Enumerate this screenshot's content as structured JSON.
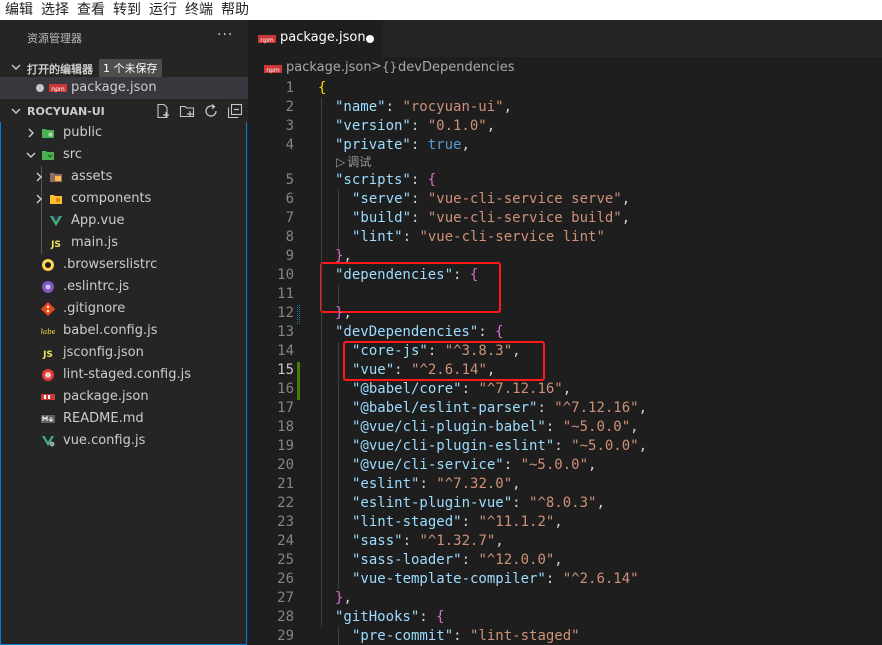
{
  "menu": [
    "编辑",
    "选择",
    "查看",
    "转到",
    "运行",
    "终端",
    "帮助"
  ],
  "sidebar": {
    "title": "资源管理器",
    "more": "···",
    "open_editors": {
      "label": "打开的编辑器",
      "badge": "1 个未保存",
      "files": [
        {
          "name": "package.json",
          "icon": "npm-icon",
          "dirty": true
        }
      ]
    },
    "project": {
      "label": "ROCYUAN-UI",
      "actions": [
        "new-file-icon",
        "new-folder-icon",
        "refresh-icon",
        "collapse-all-icon"
      ],
      "tree": [
        {
          "name": "public",
          "kind": "folder",
          "expanded": false,
          "depth": 0,
          "icon": "public-folder-icon"
        },
        {
          "name": "src",
          "kind": "folder",
          "expanded": true,
          "depth": 0,
          "icon": "src-folder-icon"
        },
        {
          "name": "assets",
          "kind": "folder",
          "expanded": false,
          "depth": 1,
          "icon": "assets-folder-icon"
        },
        {
          "name": "components",
          "kind": "folder",
          "expanded": false,
          "depth": 1,
          "icon": "components-folder-icon"
        },
        {
          "name": "App.vue",
          "kind": "file",
          "depth": 1,
          "icon": "vue-icon"
        },
        {
          "name": "main.js",
          "kind": "file",
          "depth": 1,
          "icon": "js-icon"
        },
        {
          "name": ".browserslistrc",
          "kind": "file",
          "depth": 0,
          "icon": "browserslist-icon"
        },
        {
          "name": ".eslintrc.js",
          "kind": "file",
          "depth": 0,
          "icon": "eslint-icon"
        },
        {
          "name": ".gitignore",
          "kind": "file",
          "depth": 0,
          "icon": "git-icon"
        },
        {
          "name": "babel.config.js",
          "kind": "file",
          "depth": 0,
          "icon": "babel-icon"
        },
        {
          "name": "jsconfig.json",
          "kind": "file",
          "depth": 0,
          "icon": "jsconfig-icon"
        },
        {
          "name": "lint-staged.config.js",
          "kind": "file",
          "depth": 0,
          "icon": "lint-staged-icon"
        },
        {
          "name": "package.json",
          "kind": "file",
          "depth": 0,
          "icon": "npm-icon"
        },
        {
          "name": "README.md",
          "kind": "file",
          "depth": 0,
          "icon": "readme-icon"
        },
        {
          "name": "vue.config.js",
          "kind": "file",
          "depth": 0,
          "icon": "vue-config-icon"
        }
      ]
    }
  },
  "editor": {
    "tab": {
      "label": "package.json",
      "dirty": true
    },
    "breadcrumb": {
      "file": "package.json",
      "separator": ">",
      "symbol_icon": "{}",
      "symbol": "devDependencies"
    },
    "codelens": "调试",
    "current_line": 15,
    "lines": [
      {
        "n": 1,
        "indent": 0,
        "tokens": [
          [
            "br1",
            "{"
          ]
        ]
      },
      {
        "n": 2,
        "indent": 1,
        "tokens": [
          [
            "k",
            "\"name\""
          ],
          [
            "p",
            ": "
          ],
          [
            "s",
            "\"rocyuan-ui\""
          ],
          [
            "p",
            ","
          ]
        ]
      },
      {
        "n": 3,
        "indent": 1,
        "tokens": [
          [
            "k",
            "\"version\""
          ],
          [
            "p",
            ": "
          ],
          [
            "s",
            "\"0.1.0\""
          ],
          [
            "p",
            ","
          ]
        ]
      },
      {
        "n": 4,
        "indent": 1,
        "tokens": [
          [
            "k",
            "\"private\""
          ],
          [
            "p",
            ": "
          ],
          [
            "b",
            "true"
          ],
          [
            "p",
            ","
          ]
        ]
      },
      {
        "n": 5,
        "indent": 1,
        "tokens": [
          [
            "k",
            "\"scripts\""
          ],
          [
            "p",
            ": "
          ],
          [
            "br2",
            "{"
          ]
        ]
      },
      {
        "n": 6,
        "indent": 2,
        "tokens": [
          [
            "k",
            "\"serve\""
          ],
          [
            "p",
            ": "
          ],
          [
            "s",
            "\"vue-cli-service serve\""
          ],
          [
            "p",
            ","
          ]
        ]
      },
      {
        "n": 7,
        "indent": 2,
        "tokens": [
          [
            "k",
            "\"build\""
          ],
          [
            "p",
            ": "
          ],
          [
            "s",
            "\"vue-cli-service build\""
          ],
          [
            "p",
            ","
          ]
        ]
      },
      {
        "n": 8,
        "indent": 2,
        "tokens": [
          [
            "k",
            "\"lint\""
          ],
          [
            "p",
            ": "
          ],
          [
            "s",
            "\"vue-cli-service lint\""
          ]
        ]
      },
      {
        "n": 9,
        "indent": 1,
        "tokens": [
          [
            "br2",
            "}"
          ],
          [
            "p",
            ","
          ]
        ]
      },
      {
        "n": 10,
        "indent": 1,
        "tokens": [
          [
            "k",
            "\"dependencies\""
          ],
          [
            "p",
            ": "
          ],
          [
            "br2",
            "{"
          ]
        ]
      },
      {
        "n": 11,
        "indent": 0,
        "tokens": []
      },
      {
        "n": 12,
        "indent": 1,
        "tokens": [
          [
            "br2",
            "}"
          ],
          [
            "p",
            ","
          ]
        ]
      },
      {
        "n": 13,
        "indent": 1,
        "tokens": [
          [
            "k",
            "\"devDependencies\""
          ],
          [
            "p",
            ": "
          ],
          [
            "br2",
            "{"
          ]
        ]
      },
      {
        "n": 14,
        "indent": 2,
        "tokens": [
          [
            "k",
            "\"core-js\""
          ],
          [
            "p",
            ": "
          ],
          [
            "s",
            "\"^3.8.3\""
          ],
          [
            "p",
            ","
          ]
        ]
      },
      {
        "n": 15,
        "indent": 2,
        "tokens": [
          [
            "k",
            "\"vue\""
          ],
          [
            "p",
            ": "
          ],
          [
            "s",
            "\"^2.6.14\""
          ],
          [
            "p",
            ","
          ]
        ]
      },
      {
        "n": 16,
        "indent": 2,
        "tokens": [
          [
            "k",
            "\"@babel/core\""
          ],
          [
            "p",
            ": "
          ],
          [
            "s",
            "\"^7.12.16\""
          ],
          [
            "p",
            ","
          ]
        ]
      },
      {
        "n": 17,
        "indent": 2,
        "tokens": [
          [
            "k",
            "\"@babel/eslint-parser\""
          ],
          [
            "p",
            ": "
          ],
          [
            "s",
            "\"^7.12.16\""
          ],
          [
            "p",
            ","
          ]
        ]
      },
      {
        "n": 18,
        "indent": 2,
        "tokens": [
          [
            "k",
            "\"@vue/cli-plugin-babel\""
          ],
          [
            "p",
            ": "
          ],
          [
            "s",
            "\"~5.0.0\""
          ],
          [
            "p",
            ","
          ]
        ]
      },
      {
        "n": 19,
        "indent": 2,
        "tokens": [
          [
            "k",
            "\"@vue/cli-plugin-eslint\""
          ],
          [
            "p",
            ": "
          ],
          [
            "s",
            "\"~5.0.0\""
          ],
          [
            "p",
            ","
          ]
        ]
      },
      {
        "n": 20,
        "indent": 2,
        "tokens": [
          [
            "k",
            "\"@vue/cli-service\""
          ],
          [
            "p",
            ": "
          ],
          [
            "s",
            "\"~5.0.0\""
          ],
          [
            "p",
            ","
          ]
        ]
      },
      {
        "n": 21,
        "indent": 2,
        "tokens": [
          [
            "k",
            "\"eslint\""
          ],
          [
            "p",
            ": "
          ],
          [
            "s",
            "\"^7.32.0\""
          ],
          [
            "p",
            ","
          ]
        ]
      },
      {
        "n": 22,
        "indent": 2,
        "tokens": [
          [
            "k",
            "\"eslint-plugin-vue\""
          ],
          [
            "p",
            ": "
          ],
          [
            "s",
            "\"^8.0.3\""
          ],
          [
            "p",
            ","
          ]
        ]
      },
      {
        "n": 23,
        "indent": 2,
        "tokens": [
          [
            "k",
            "\"lint-staged\""
          ],
          [
            "p",
            ": "
          ],
          [
            "s",
            "\"^11.1.2\""
          ],
          [
            "p",
            ","
          ]
        ]
      },
      {
        "n": 24,
        "indent": 2,
        "tokens": [
          [
            "k",
            "\"sass\""
          ],
          [
            "p",
            ": "
          ],
          [
            "s",
            "\"^1.32.7\""
          ],
          [
            "p",
            ","
          ]
        ]
      },
      {
        "n": 25,
        "indent": 2,
        "tokens": [
          [
            "k",
            "\"sass-loader\""
          ],
          [
            "p",
            ": "
          ],
          [
            "s",
            "\"^12.0.0\""
          ],
          [
            "p",
            ","
          ]
        ]
      },
      {
        "n": 26,
        "indent": 2,
        "tokens": [
          [
            "k",
            "\"vue-template-compiler\""
          ],
          [
            "p",
            ": "
          ],
          [
            "s",
            "\"^2.6.14\""
          ]
        ]
      },
      {
        "n": 27,
        "indent": 1,
        "tokens": [
          [
            "br2",
            "}"
          ],
          [
            "p",
            ","
          ]
        ]
      },
      {
        "n": 28,
        "indent": 1,
        "tokens": [
          [
            "k",
            "\"gitHooks\""
          ],
          [
            "p",
            ": "
          ],
          [
            "br2",
            "{"
          ]
        ]
      },
      {
        "n": 29,
        "indent": 2,
        "tokens": [
          [
            "k",
            "\"pre-commit\""
          ],
          [
            "p",
            ": "
          ],
          [
            "s",
            "\"lint-staged\""
          ]
        ]
      }
    ]
  },
  "colors": {
    "highlight_box": "#ff1a1a",
    "modified_gutter": "#487e02",
    "focus_border": "#007fd4"
  }
}
